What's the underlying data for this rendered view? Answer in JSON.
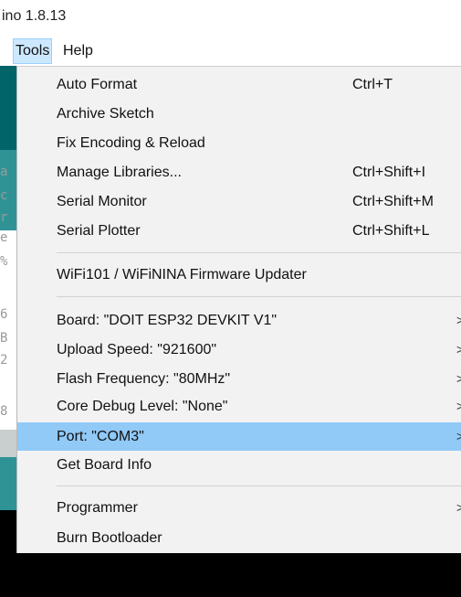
{
  "window": {
    "title": "ino 1.8.13"
  },
  "menubar": {
    "items": [
      {
        "label": "Tools",
        "open": true
      },
      {
        "label": "Help",
        "open": false
      }
    ]
  },
  "editor_margin": {
    "chars": [
      "a",
      "c",
      "r",
      "e",
      "%",
      "6",
      "B",
      "2",
      "8"
    ]
  },
  "tools_menu": {
    "items": [
      {
        "label": "Auto Format",
        "shortcut": "Ctrl+T",
        "submenu": false,
        "highlight": false
      },
      {
        "label": "Archive Sketch",
        "shortcut": "",
        "submenu": false,
        "highlight": false
      },
      {
        "label": "Fix Encoding & Reload",
        "shortcut": "",
        "submenu": false,
        "highlight": false
      },
      {
        "label": "Manage Libraries...",
        "shortcut": "Ctrl+Shift+I",
        "submenu": false,
        "highlight": false
      },
      {
        "label": "Serial Monitor",
        "shortcut": "Ctrl+Shift+M",
        "submenu": false,
        "highlight": false
      },
      {
        "label": "Serial Plotter",
        "shortcut": "Ctrl+Shift+L",
        "submenu": false,
        "highlight": false
      },
      {
        "label": "WiFi101 / WiFiNINA Firmware Updater",
        "shortcut": "",
        "submenu": false,
        "highlight": false
      },
      {
        "label": "Board: \"DOIT ESP32 DEVKIT V1\"",
        "shortcut": "",
        "submenu": true,
        "highlight": false
      },
      {
        "label": "Upload Speed: \"921600\"",
        "shortcut": "",
        "submenu": true,
        "highlight": false
      },
      {
        "label": "Flash Frequency: \"80MHz\"",
        "shortcut": "",
        "submenu": true,
        "highlight": false
      },
      {
        "label": "Core Debug Level: \"None\"",
        "shortcut": "",
        "submenu": true,
        "highlight": false
      },
      {
        "label": "Port: \"COM3\"",
        "shortcut": "",
        "submenu": true,
        "highlight": true
      },
      {
        "label": "Get Board Info",
        "shortcut": "",
        "submenu": false,
        "highlight": false
      },
      {
        "label": "Programmer",
        "shortcut": "",
        "submenu": true,
        "highlight": false
      },
      {
        "label": "Burn Bootloader",
        "shortcut": "",
        "submenu": false,
        "highlight": false
      }
    ],
    "submenu_glyph": ">",
    "colors": {
      "menu_bg": "#f2f2f2",
      "highlight": "#91c9f7",
      "menubar_open": "#cce8ff"
    }
  }
}
